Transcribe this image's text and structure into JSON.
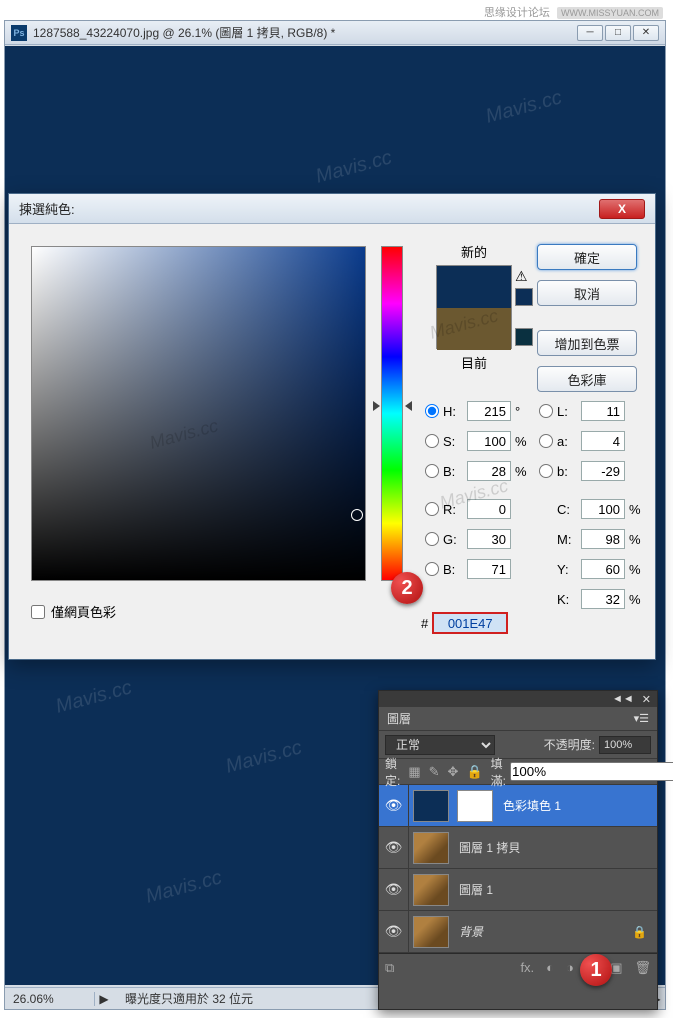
{
  "watermark": {
    "text": "思缘设计论坛",
    "url": "WWW.MISSYUAN.COM",
    "diag": "Mavis.cc"
  },
  "window": {
    "title": "1287588_43224070.jpg @ 26.1% (圖層 1 拷貝, RGB/8) *",
    "zoom": "26.06%",
    "status_info": "曝光度只適用於 32 位元"
  },
  "color_picker": {
    "title": "揀選純色:",
    "new_label": "新的",
    "current_label": "目前",
    "buttons": {
      "ok": "確定",
      "cancel": "取消",
      "add_swatch": "增加到色票",
      "libraries": "色彩庫"
    },
    "values": {
      "H": "215",
      "H_unit": "°",
      "S": "100",
      "S_unit": "%",
      "B": "28",
      "B_unit": "%",
      "R": "0",
      "G": "30",
      "Bb": "71",
      "L": "11",
      "a": "4",
      "b": "-29",
      "C": "100",
      "C_unit": "%",
      "M": "98",
      "M_unit": "%",
      "Y": "60",
      "Y_unit": "%",
      "K": "32",
      "K_unit": "%"
    },
    "hex": "001E47",
    "web_only": "僅網頁色彩"
  },
  "layers_panel": {
    "tab": "圖層",
    "blend_mode": "正常",
    "opacity_label": "不透明度:",
    "opacity": "100%",
    "lock_label": "鎖定:",
    "fill_label": "填滿:",
    "fill": "100%",
    "layers": [
      {
        "name": "色彩填色 1"
      },
      {
        "name": "圖層 1 拷貝"
      },
      {
        "name": "圖層 1"
      },
      {
        "name": "背景"
      }
    ]
  },
  "badges": {
    "one": "1",
    "two": "2"
  }
}
